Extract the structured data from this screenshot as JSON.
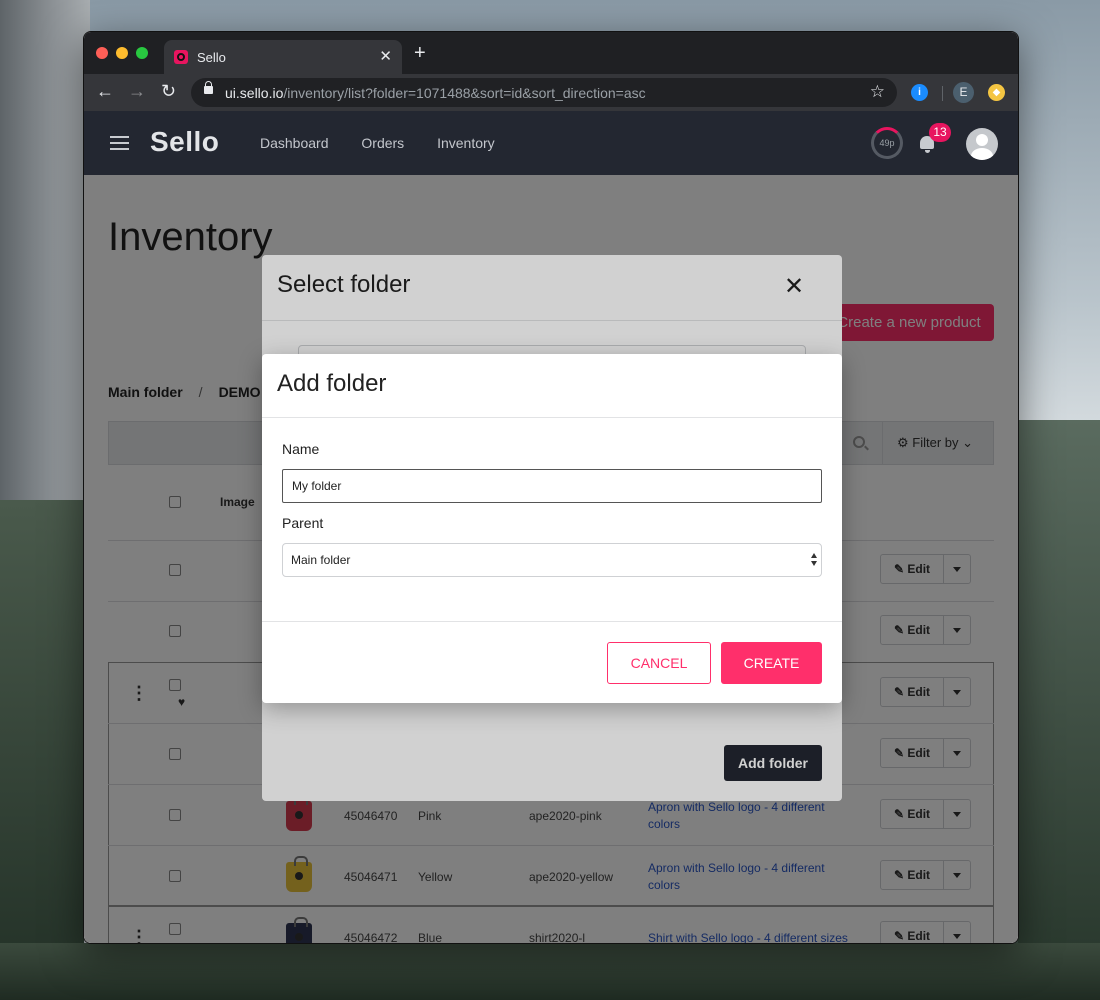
{
  "browser": {
    "tab_title": "Sello",
    "url_host": "ui.sello.io",
    "url_path": "/inventory/list?folder=1071488&sort=id&sort_direction=asc",
    "profile_initial": "E"
  },
  "header": {
    "logo": "Sello",
    "nav": [
      "Dashboard",
      "Orders",
      "Inventory"
    ],
    "usage": "49p",
    "notification_count": "13"
  },
  "page": {
    "title": "Inventory",
    "create_product_label": "Create a new product",
    "breadcrumb": [
      "Main folder",
      "DEMO"
    ],
    "filter_label": "Filter by",
    "image_header": "Image"
  },
  "rows": [
    {
      "id": "45046470",
      "variant": "Pink",
      "sku": "ape2020-pink",
      "title": "Apron with Sello logo - 4 different colors"
    },
    {
      "id": "45046471",
      "variant": "Yellow",
      "sku": "ape2020-yellow",
      "title": "Apron with Sello logo - 4 different colors"
    },
    {
      "id": "45046472",
      "variant": "Blue",
      "sku": "shirt2020-l",
      "title": "Shirt with Sello logo - 4 different sizes"
    }
  ],
  "edit_label": "Edit",
  "select_folder_modal": {
    "title": "Select folder",
    "add_folder_label": "Add folder"
  },
  "add_folder_modal": {
    "title": "Add folder",
    "name_label": "Name",
    "name_value": "My folder",
    "parent_label": "Parent",
    "parent_value": "Main folder",
    "cancel_label": "CANCEL",
    "create_label": "CREATE"
  },
  "colors": {
    "accent": "#ff2f6b",
    "header_bg": "#232731",
    "link": "#2a56c6"
  }
}
